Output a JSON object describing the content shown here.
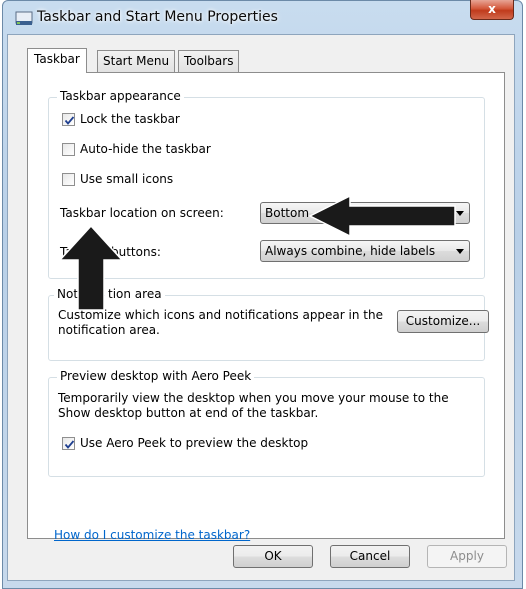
{
  "window": {
    "title": "Taskbar and Start Menu Properties",
    "close_label": "x"
  },
  "tabs": [
    {
      "label": "Taskbar",
      "selected": true
    },
    {
      "label": "Start Menu",
      "selected": false
    },
    {
      "label": "Toolbars",
      "selected": false
    }
  ],
  "taskbar_appearance": {
    "legend": "Taskbar appearance",
    "lock_taskbar": {
      "label": "Lock the taskbar",
      "checked": true
    },
    "auto_hide": {
      "label": "Auto-hide the taskbar",
      "checked": false
    },
    "small_icons": {
      "label": "Use small icons",
      "checked": false
    },
    "location_label": "Taskbar location on screen:",
    "location_value": "Bottom",
    "buttons_label_left": "Tas",
    "buttons_label_right": "buttons:",
    "buttons_value": "Always combine, hide labels"
  },
  "notification_area": {
    "legend_left": "Not",
    "legend_right": "tion area",
    "description": "Customize which icons and notifications appear in the notification area.",
    "customize_label": "Customize..."
  },
  "aero_peek": {
    "legend": "Preview desktop with Aero Peek",
    "description": "Temporarily view the desktop when you move your mouse to the Show desktop button at end of the taskbar.",
    "use_peek": {
      "label": "Use Aero Peek to preview the desktop",
      "checked": true
    }
  },
  "help_link": "How do I customize the taskbar?",
  "buttons": {
    "ok": "OK",
    "cancel": "Cancel",
    "apply": "Apply"
  },
  "colors": {
    "link": "#0066cc",
    "annotation_arrow": "#1a1a1a",
    "close_button": "#c8452a"
  }
}
